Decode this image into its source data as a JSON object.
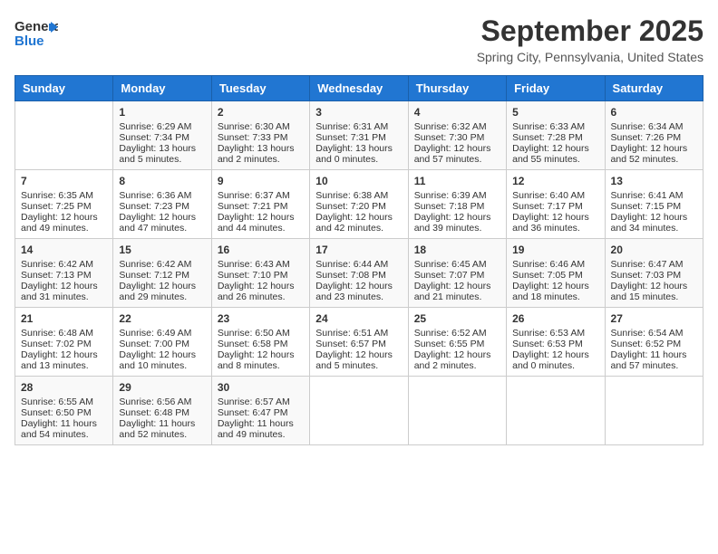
{
  "header": {
    "logo_general": "General",
    "logo_blue": "Blue",
    "month_title": "September 2025",
    "location": "Spring City, Pennsylvania, United States"
  },
  "weekdays": [
    "Sunday",
    "Monday",
    "Tuesday",
    "Wednesday",
    "Thursday",
    "Friday",
    "Saturday"
  ],
  "weeks": [
    [
      {
        "day": "",
        "info": ""
      },
      {
        "day": "1",
        "info": "Sunrise: 6:29 AM\nSunset: 7:34 PM\nDaylight: 13 hours\nand 5 minutes."
      },
      {
        "day": "2",
        "info": "Sunrise: 6:30 AM\nSunset: 7:33 PM\nDaylight: 13 hours\nand 2 minutes."
      },
      {
        "day": "3",
        "info": "Sunrise: 6:31 AM\nSunset: 7:31 PM\nDaylight: 13 hours\nand 0 minutes."
      },
      {
        "day": "4",
        "info": "Sunrise: 6:32 AM\nSunset: 7:30 PM\nDaylight: 12 hours\nand 57 minutes."
      },
      {
        "day": "5",
        "info": "Sunrise: 6:33 AM\nSunset: 7:28 PM\nDaylight: 12 hours\nand 55 minutes."
      },
      {
        "day": "6",
        "info": "Sunrise: 6:34 AM\nSunset: 7:26 PM\nDaylight: 12 hours\nand 52 minutes."
      }
    ],
    [
      {
        "day": "7",
        "info": "Sunrise: 6:35 AM\nSunset: 7:25 PM\nDaylight: 12 hours\nand 49 minutes."
      },
      {
        "day": "8",
        "info": "Sunrise: 6:36 AM\nSunset: 7:23 PM\nDaylight: 12 hours\nand 47 minutes."
      },
      {
        "day": "9",
        "info": "Sunrise: 6:37 AM\nSunset: 7:21 PM\nDaylight: 12 hours\nand 44 minutes."
      },
      {
        "day": "10",
        "info": "Sunrise: 6:38 AM\nSunset: 7:20 PM\nDaylight: 12 hours\nand 42 minutes."
      },
      {
        "day": "11",
        "info": "Sunrise: 6:39 AM\nSunset: 7:18 PM\nDaylight: 12 hours\nand 39 minutes."
      },
      {
        "day": "12",
        "info": "Sunrise: 6:40 AM\nSunset: 7:17 PM\nDaylight: 12 hours\nand 36 minutes."
      },
      {
        "day": "13",
        "info": "Sunrise: 6:41 AM\nSunset: 7:15 PM\nDaylight: 12 hours\nand 34 minutes."
      }
    ],
    [
      {
        "day": "14",
        "info": "Sunrise: 6:42 AM\nSunset: 7:13 PM\nDaylight: 12 hours\nand 31 minutes."
      },
      {
        "day": "15",
        "info": "Sunrise: 6:42 AM\nSunset: 7:12 PM\nDaylight: 12 hours\nand 29 minutes."
      },
      {
        "day": "16",
        "info": "Sunrise: 6:43 AM\nSunset: 7:10 PM\nDaylight: 12 hours\nand 26 minutes."
      },
      {
        "day": "17",
        "info": "Sunrise: 6:44 AM\nSunset: 7:08 PM\nDaylight: 12 hours\nand 23 minutes."
      },
      {
        "day": "18",
        "info": "Sunrise: 6:45 AM\nSunset: 7:07 PM\nDaylight: 12 hours\nand 21 minutes."
      },
      {
        "day": "19",
        "info": "Sunrise: 6:46 AM\nSunset: 7:05 PM\nDaylight: 12 hours\nand 18 minutes."
      },
      {
        "day": "20",
        "info": "Sunrise: 6:47 AM\nSunset: 7:03 PM\nDaylight: 12 hours\nand 15 minutes."
      }
    ],
    [
      {
        "day": "21",
        "info": "Sunrise: 6:48 AM\nSunset: 7:02 PM\nDaylight: 12 hours\nand 13 minutes."
      },
      {
        "day": "22",
        "info": "Sunrise: 6:49 AM\nSunset: 7:00 PM\nDaylight: 12 hours\nand 10 minutes."
      },
      {
        "day": "23",
        "info": "Sunrise: 6:50 AM\nSunset: 6:58 PM\nDaylight: 12 hours\nand 8 minutes."
      },
      {
        "day": "24",
        "info": "Sunrise: 6:51 AM\nSunset: 6:57 PM\nDaylight: 12 hours\nand 5 minutes."
      },
      {
        "day": "25",
        "info": "Sunrise: 6:52 AM\nSunset: 6:55 PM\nDaylight: 12 hours\nand 2 minutes."
      },
      {
        "day": "26",
        "info": "Sunrise: 6:53 AM\nSunset: 6:53 PM\nDaylight: 12 hours\nand 0 minutes."
      },
      {
        "day": "27",
        "info": "Sunrise: 6:54 AM\nSunset: 6:52 PM\nDaylight: 11 hours\nand 57 minutes."
      }
    ],
    [
      {
        "day": "28",
        "info": "Sunrise: 6:55 AM\nSunset: 6:50 PM\nDaylight: 11 hours\nand 54 minutes."
      },
      {
        "day": "29",
        "info": "Sunrise: 6:56 AM\nSunset: 6:48 PM\nDaylight: 11 hours\nand 52 minutes."
      },
      {
        "day": "30",
        "info": "Sunrise: 6:57 AM\nSunset: 6:47 PM\nDaylight: 11 hours\nand 49 minutes."
      },
      {
        "day": "",
        "info": ""
      },
      {
        "day": "",
        "info": ""
      },
      {
        "day": "",
        "info": ""
      },
      {
        "day": "",
        "info": ""
      }
    ]
  ]
}
